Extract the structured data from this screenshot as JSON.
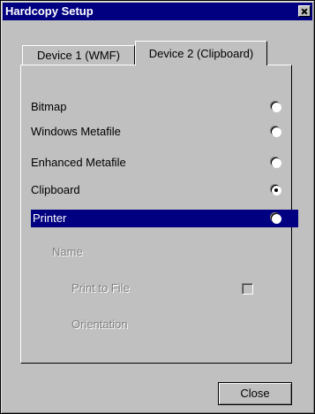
{
  "window": {
    "title": "Hardcopy Setup"
  },
  "tabs": [
    {
      "label": "Device 1 (WMF)",
      "active": false
    },
    {
      "label": "Device 2 (Clipboard)",
      "active": true
    }
  ],
  "options": [
    {
      "label": "Bitmap",
      "checked": false
    },
    {
      "label": "Windows Metafile",
      "checked": false
    },
    {
      "label": "Enhanced Metafile",
      "checked": false
    },
    {
      "label": "Clipboard",
      "checked": true
    },
    {
      "label": "Printer",
      "checked": false
    }
  ],
  "printer_settings": {
    "name_label": "Name",
    "print_to_file_label": "Print to File",
    "print_to_file_checked": false,
    "orientation_label": "Orientation"
  },
  "buttons": {
    "close_label": "Close"
  },
  "colors": {
    "title_bg": "#000080",
    "face": "#c0c0c0",
    "disabled_text": "#808080"
  }
}
